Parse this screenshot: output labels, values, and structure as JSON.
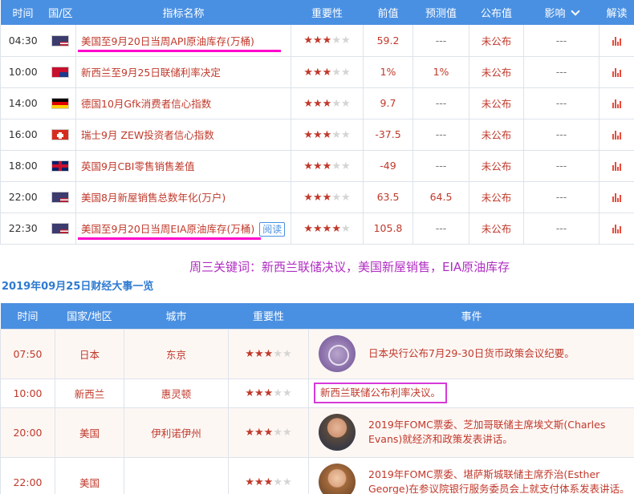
{
  "calendar": {
    "headers": [
      "时间",
      "国/区",
      "指标名称",
      "重要性",
      "前值",
      "预测值",
      "公布值",
      "影响",
      "解读"
    ],
    "rows": [
      {
        "time": "04:30",
        "flag": "us-flag-icon",
        "name": "美国至9月20日当周API原油库存(万桶)",
        "stars": 3,
        "prev": "59.2",
        "forecast": "---",
        "actual": "未公布",
        "impact": "---"
      },
      {
        "time": "10:00",
        "flag": "nz-flag-icon",
        "name": "新西兰至9月25日联储利率决定",
        "stars": 3,
        "prev": "1%",
        "forecast": "1%",
        "actual": "未公布",
        "impact": "---"
      },
      {
        "time": "14:00",
        "flag": "de-flag-icon",
        "name": "德国10月Gfk消费者信心指数",
        "stars": 3,
        "prev": "9.7",
        "forecast": "---",
        "actual": "未公布",
        "impact": "---"
      },
      {
        "time": "16:00",
        "flag": "ch-flag-icon",
        "name": "瑞士9月 ZEW投资者信心指数",
        "stars": 3,
        "prev": "-37.5",
        "forecast": "---",
        "actual": "未公布",
        "impact": "---"
      },
      {
        "time": "18:00",
        "flag": "uk-flag-icon",
        "name": "英国9月CBI零售销售差值",
        "stars": 3,
        "prev": "-49",
        "forecast": "---",
        "actual": "未公布",
        "impact": "---"
      },
      {
        "time": "22:00",
        "flag": "us-flag-icon",
        "name": "美国8月新屋销售总数年化(万户)",
        "stars": 3,
        "prev": "63.5",
        "forecast": "64.5",
        "actual": "未公布",
        "impact": "---"
      },
      {
        "time": "22:30",
        "flag": "us-flag-icon",
        "name": "美国至9月20日当周EIA原油库存(万桶)",
        "stars": 4,
        "prev": "105.8",
        "forecast": "---",
        "actual": "未公布",
        "impact": "---",
        "read_label": "阅读"
      }
    ],
    "star_total": 5,
    "analysis_icon": "bar-chart-icon"
  },
  "keywords": "周三关键词：新西兰联储决议，美国新屋销售，EIA原油库存",
  "events_title": "2019年09月25日财经大事一览",
  "events": {
    "headers": [
      "时间",
      "国家/地区",
      "城市",
      "重要性",
      "事件"
    ],
    "rows": [
      {
        "time": "07:50",
        "country": "日本",
        "city": "东京",
        "stars": 3,
        "image": "boj-seal-icon",
        "event": "日本央行公布7月29-30日货币政策会议纪要。"
      },
      {
        "time": "10:00",
        "country": "新西兰",
        "city": "惠灵顿",
        "stars": 3,
        "image": "",
        "event": "新西兰联储公布利率决议。"
      },
      {
        "time": "20:00",
        "country": "美国",
        "city": "伊利诺伊州",
        "stars": 3,
        "image": "evans-portrait",
        "event": "2019年FOMC票委、芝加哥联储主席埃文斯(Charles Evans)就经济和政策发表讲话。"
      },
      {
        "time": "22:00",
        "country": "美国",
        "city": "",
        "stars": 3,
        "image": "george-portrait",
        "event": "2019年FOMC票委、堪萨斯城联储主席乔治(Esther George)在参议院银行服务委员会上就支付体系发表讲话。"
      }
    ]
  },
  "colors": {
    "header_bg": "#4a90e2",
    "accent_red": "#c0392b",
    "highlight_magenta": "#ff00cc",
    "keyword_purple": "#b02ec2"
  }
}
